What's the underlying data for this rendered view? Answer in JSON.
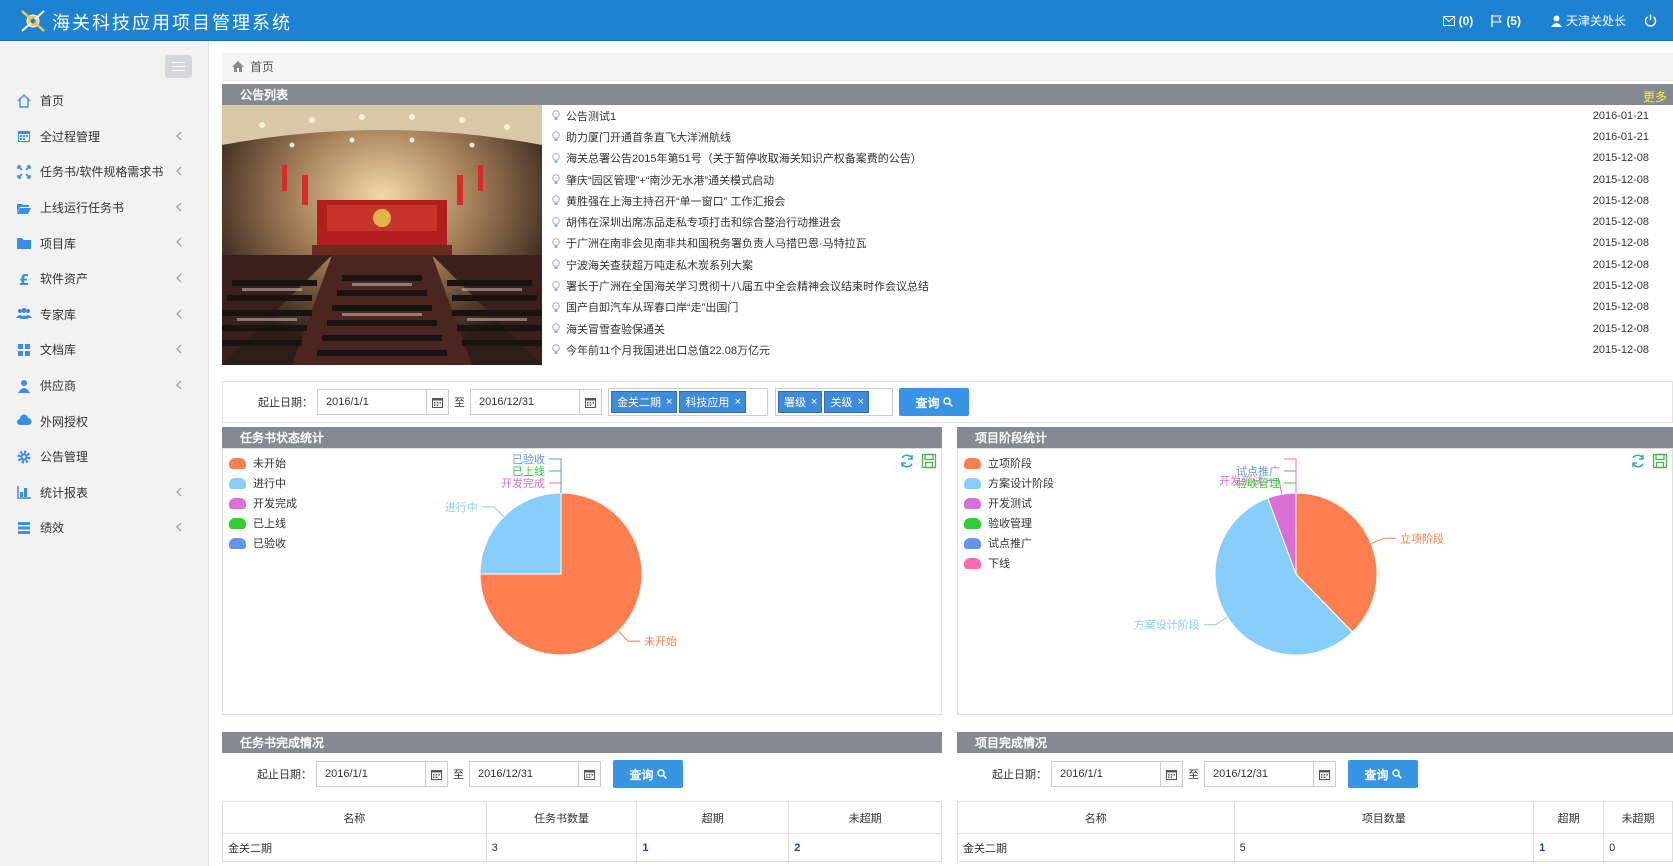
{
  "app": {
    "title": "海关科技应用项目管理系统"
  },
  "topbar": {
    "messages_count": "(0)",
    "flags_count": "(5)",
    "user_name": "天津关处长"
  },
  "sidebar": {
    "items": [
      {
        "label": "首页",
        "icon": "home-icon"
      },
      {
        "label": "全过程管理",
        "icon": "calendar-icon"
      },
      {
        "label": "任务书/软件规格需求书",
        "icon": "expand-icon"
      },
      {
        "label": "上线运行任务书",
        "icon": "folder-open-icon"
      },
      {
        "label": "项目库",
        "icon": "folder-icon"
      },
      {
        "label": "软件资产",
        "icon": "pound-icon"
      },
      {
        "label": "专家库",
        "icon": "users-icon"
      },
      {
        "label": "文档库",
        "icon": "grid-icon"
      },
      {
        "label": "供应商",
        "icon": "user-icon"
      },
      {
        "label": "外网授权",
        "icon": "cloud-icon"
      },
      {
        "label": "公告管理",
        "icon": "gear-icon"
      },
      {
        "label": "统计报表",
        "icon": "chart-icon"
      },
      {
        "label": "绩效",
        "icon": "stack-icon"
      }
    ]
  },
  "breadcrumb": {
    "home": "首页"
  },
  "notices": {
    "title": "公告列表",
    "more": "更多",
    "items": [
      {
        "text": "公告测试1",
        "date": "2016-01-21"
      },
      {
        "text": "助力厦门开通首条直飞大洋洲航线",
        "date": "2016-01-21"
      },
      {
        "text": "海关总署公告2015年第51号（关于暂停收取海关知识产权备案费的公告）",
        "date": "2015-12-08"
      },
      {
        "text": "肇庆“园区管理”+“南沙无水港”通关模式启动",
        "date": "2015-12-08"
      },
      {
        "text": "黄胜强在上海主持召开“单一窗口” 工作汇报会",
        "date": "2015-12-08"
      },
      {
        "text": "胡伟在深圳出席冻品走私专项打击和综合整治行动推进会",
        "date": "2015-12-08"
      },
      {
        "text": "于广洲在南非会见南非共和国税务署负责人马措巴恩·马特拉瓦",
        "date": "2015-12-08"
      },
      {
        "text": "宁波海关查获超万吨走私木炭系列大案",
        "date": "2015-12-08"
      },
      {
        "text": "署长于广洲在全国海关学习贯彻十八届五中全会精神会议结束时作会议总结",
        "date": "2015-12-08"
      },
      {
        "text": "国产自卸汽车从珲春口岸“走”出国门",
        "date": "2015-12-08"
      },
      {
        "text": "海关冒雪查验保通关",
        "date": "2015-12-08"
      },
      {
        "text": "今年前11个月我国进出口总值22.08万亿元",
        "date": "2015-12-08"
      }
    ]
  },
  "filter_top": {
    "date_label": "起止日期：",
    "start": "2016/1/1",
    "to": "至",
    "end": "2016/12/31",
    "tags_a": [
      "金关二期",
      "科技应用"
    ],
    "tags_b": [
      "署级",
      "关级"
    ],
    "query": "查询"
  },
  "task_status_panel": {
    "title": "任务书状态统计"
  },
  "project_stage_panel": {
    "title": "项目阶段统计"
  },
  "task_complete_panel": {
    "title": "任务书完成情况",
    "date_label": "起止日期：",
    "start": "2016/1/1",
    "to": "至",
    "end": "2016/12/31",
    "query": "查询",
    "columns": [
      "名称",
      "任务书数量",
      "超期",
      "未超期"
    ],
    "rows": [
      [
        "金关二期",
        "3",
        "1",
        "2"
      ]
    ]
  },
  "project_complete_panel": {
    "title": "项目完成情况",
    "date_label": "起止日期：",
    "start": "2016/1/1",
    "to": "至",
    "end": "2016/12/31",
    "query": "查询",
    "columns": [
      "名称",
      "项目数量",
      "超期",
      "未超期"
    ],
    "rows": [
      [
        "金关二期",
        "5",
        "1",
        "0"
      ]
    ]
  },
  "chart_data": [
    {
      "type": "pie",
      "title": "任务书状态统计",
      "categories": [
        "未开始",
        "进行中",
        "开发完成",
        "已上线",
        "已验收"
      ],
      "values": [
        3,
        1,
        0,
        0,
        0
      ],
      "colors": [
        "#ff7f50",
        "#87cefa",
        "#da70d6",
        "#32cd32",
        "#6495ed"
      ],
      "legend_position": "top-left"
    },
    {
      "type": "pie",
      "title": "项目阶段统计",
      "categories": [
        "立项阶段",
        "方案设计阶段",
        "开发测试",
        "验收管理",
        "试点推广",
        "下线"
      ],
      "values": [
        4,
        6,
        0.6,
        0,
        0,
        0
      ],
      "colors": [
        "#ff7f50",
        "#87cefa",
        "#da70d6",
        "#32cd32",
        "#6495ed",
        "#ff69b4"
      ],
      "legend_position": "top-left"
    }
  ]
}
